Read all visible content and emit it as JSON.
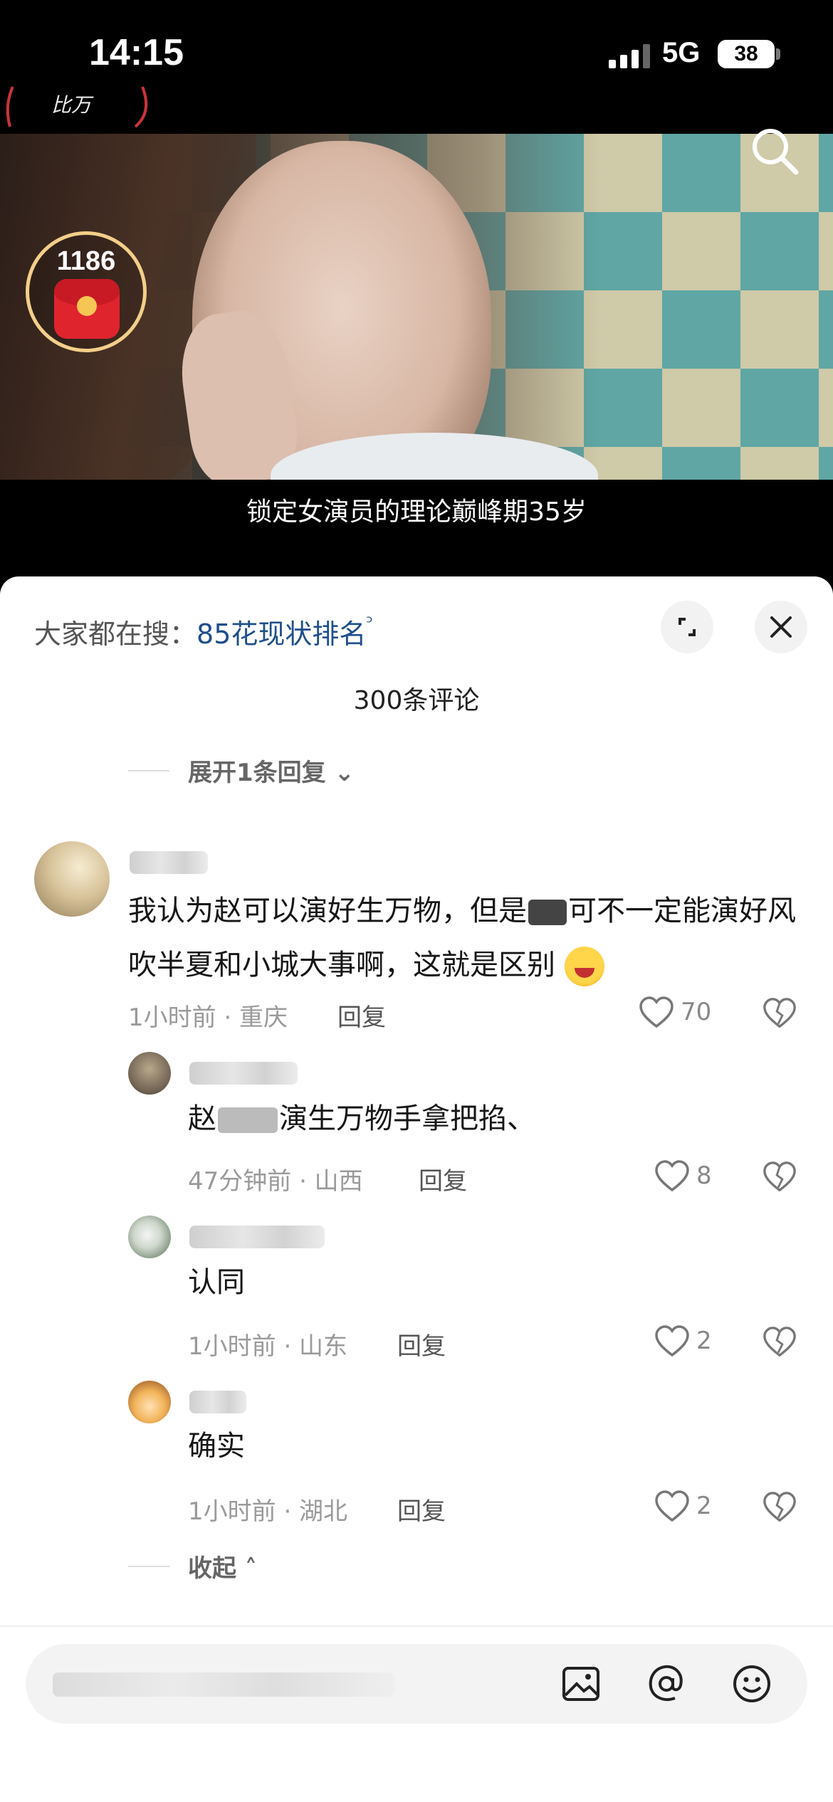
{
  "status_bar": {
    "time": "14:15",
    "network": "5G",
    "battery": "38"
  },
  "video": {
    "tag_fragment": "比万",
    "redpacket_count": "1186",
    "caption": "锁定女演员的理论巅峰期35岁"
  },
  "sheet": {
    "hot_search_prefix": "大家都在搜：",
    "hot_search_term": "85花现状排名",
    "comment_count": "300条评论",
    "expand_replies": "展开1条回复",
    "collapse": "收起"
  },
  "comments": [
    {
      "text_a": "我认为赵可以演好生万物，但是",
      "text_b": "可不一定能演好风吹半夏和小城大事啊，这就是区别",
      "time_location": "1小时前 · 重庆",
      "reply_label": "回复",
      "likes": "70"
    }
  ],
  "replies": [
    {
      "text_a": "赵",
      "text_b": "演生万物手拿把掐、",
      "time_location": "47分钟前 · 山西",
      "reply_label": "回复",
      "likes": "8"
    },
    {
      "text": "认同",
      "time_location": "1小时前 · 山东",
      "reply_label": "回复",
      "likes": "2"
    },
    {
      "text": "确实",
      "time_location": "1小时前 · 湖北",
      "reply_label": "回复",
      "likes": "2"
    }
  ],
  "icons": [
    "search-icon",
    "red-packet-icon",
    "expand-icon",
    "close-icon",
    "heart-icon",
    "dislike-icon",
    "image-icon",
    "at-icon",
    "emoji-icon"
  ]
}
